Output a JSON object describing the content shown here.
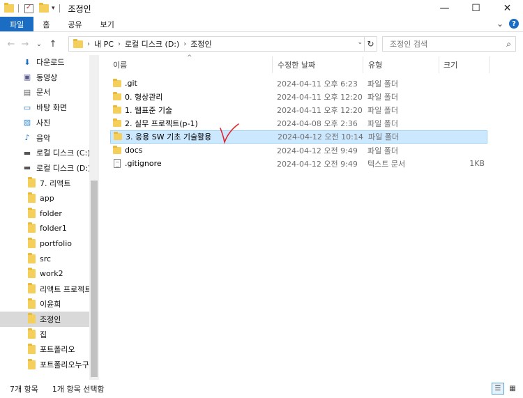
{
  "window": {
    "title": "조정인",
    "minimize": "—",
    "maximize": "☐",
    "close": "✕"
  },
  "ribbon": {
    "tabs": [
      "파일",
      "홈",
      "공유",
      "보기"
    ],
    "expand": "⌄",
    "help": "?"
  },
  "nav": {
    "back": "←",
    "forward": "→",
    "recent": "⌄",
    "up": "↑"
  },
  "address": {
    "crumbs": [
      "내 PC",
      "로컬 디스크 (D:)",
      "조정인"
    ],
    "refresh": "↻"
  },
  "search": {
    "placeholder": "조정인 검색",
    "icon": "⚲"
  },
  "sidebar": {
    "items": [
      {
        "label": "다운로드",
        "icon": "download-icon"
      },
      {
        "label": "동영상",
        "icon": "video-icon"
      },
      {
        "label": "문서",
        "icon": "document-icon"
      },
      {
        "label": "바탕 화면",
        "icon": "desktop-icon"
      },
      {
        "label": "사진",
        "icon": "pictures-icon"
      },
      {
        "label": "음악",
        "icon": "music-icon"
      },
      {
        "label": "로컬 디스크 (C:)",
        "icon": "drive-icon"
      },
      {
        "label": "로컬 디스크 (D:)",
        "icon": "drive-icon"
      },
      {
        "label": "7. 리액트",
        "icon": "folder-icon"
      },
      {
        "label": "app",
        "icon": "folder-icon"
      },
      {
        "label": "folder",
        "icon": "folder-icon"
      },
      {
        "label": "folder1",
        "icon": "folder-icon"
      },
      {
        "label": "portfolio",
        "icon": "folder-icon"
      },
      {
        "label": "src",
        "icon": "folder-icon"
      },
      {
        "label": "work2",
        "icon": "folder-icon"
      },
      {
        "label": "리액트 프로젝트",
        "icon": "folder-icon"
      },
      {
        "label": "이윤희",
        "icon": "folder-icon"
      },
      {
        "label": "조정인",
        "icon": "folder-icon"
      },
      {
        "label": "집",
        "icon": "folder-icon"
      },
      {
        "label": "포트폴리오",
        "icon": "folder-icon"
      },
      {
        "label": "포트폴리오누구",
        "icon": "folder-icon"
      }
    ]
  },
  "columns": {
    "name": "이름",
    "date": "수정한 날짜",
    "type": "유형",
    "size": "크기",
    "sort_caret": "^"
  },
  "files": [
    {
      "name": ".git",
      "date": "2024-04-11 오후 6:23",
      "type": "파일 폴더",
      "size": "",
      "kind": "folder"
    },
    {
      "name": "0. 형상관리",
      "date": "2024-04-11 오후 12:20",
      "type": "파일 폴더",
      "size": "",
      "kind": "folder"
    },
    {
      "name": "1. 웹표준 기술",
      "date": "2024-04-11 오후 12:20",
      "type": "파일 폴더",
      "size": "",
      "kind": "folder"
    },
    {
      "name": "2. 실무 프로젝트(p-1)",
      "date": "2024-04-08 오후 2:36",
      "type": "파일 폴더",
      "size": "",
      "kind": "folder"
    },
    {
      "name": "3. 응용 SW 기초 기술활용",
      "date": "2024-04-12 오전 10:14",
      "type": "파일 폴더",
      "size": "",
      "kind": "folder",
      "selected": true
    },
    {
      "name": "docs",
      "date": "2024-04-12 오전 9:49",
      "type": "파일 폴더",
      "size": "",
      "kind": "folder"
    },
    {
      "name": ".gitignore",
      "date": "2024-04-12 오전 9:49",
      "type": "텍스트 문서",
      "size": "1KB",
      "kind": "file"
    }
  ],
  "status": {
    "count": "7개 항목",
    "selection": "1개 항목 선택함"
  },
  "colors": {
    "accent": "#1a6dc2",
    "selection": "#cce8ff",
    "folder": "#f5cf5b",
    "annotation": "#e0252a"
  }
}
